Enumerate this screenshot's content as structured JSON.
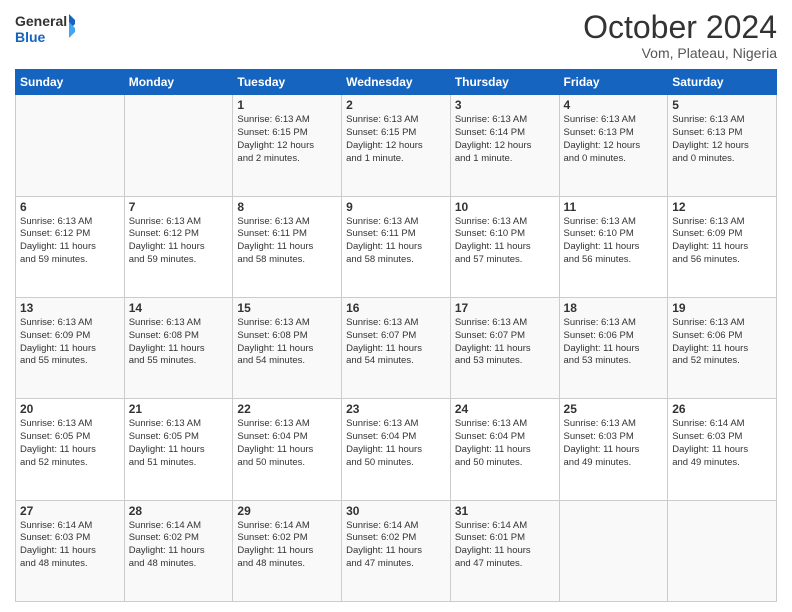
{
  "header": {
    "logo_general": "General",
    "logo_blue": "Blue",
    "month_title": "October 2024",
    "location": "Vom, Plateau, Nigeria"
  },
  "days_of_week": [
    "Sunday",
    "Monday",
    "Tuesday",
    "Wednesday",
    "Thursday",
    "Friday",
    "Saturday"
  ],
  "weeks": [
    [
      {
        "day": "",
        "info": ""
      },
      {
        "day": "",
        "info": ""
      },
      {
        "day": "1",
        "info": "Sunrise: 6:13 AM\nSunset: 6:15 PM\nDaylight: 12 hours\nand 2 minutes."
      },
      {
        "day": "2",
        "info": "Sunrise: 6:13 AM\nSunset: 6:15 PM\nDaylight: 12 hours\nand 1 minute."
      },
      {
        "day": "3",
        "info": "Sunrise: 6:13 AM\nSunset: 6:14 PM\nDaylight: 12 hours\nand 1 minute."
      },
      {
        "day": "4",
        "info": "Sunrise: 6:13 AM\nSunset: 6:13 PM\nDaylight: 12 hours\nand 0 minutes."
      },
      {
        "day": "5",
        "info": "Sunrise: 6:13 AM\nSunset: 6:13 PM\nDaylight: 12 hours\nand 0 minutes."
      }
    ],
    [
      {
        "day": "6",
        "info": "Sunrise: 6:13 AM\nSunset: 6:12 PM\nDaylight: 11 hours\nand 59 minutes."
      },
      {
        "day": "7",
        "info": "Sunrise: 6:13 AM\nSunset: 6:12 PM\nDaylight: 11 hours\nand 59 minutes."
      },
      {
        "day": "8",
        "info": "Sunrise: 6:13 AM\nSunset: 6:11 PM\nDaylight: 11 hours\nand 58 minutes."
      },
      {
        "day": "9",
        "info": "Sunrise: 6:13 AM\nSunset: 6:11 PM\nDaylight: 11 hours\nand 58 minutes."
      },
      {
        "day": "10",
        "info": "Sunrise: 6:13 AM\nSunset: 6:10 PM\nDaylight: 11 hours\nand 57 minutes."
      },
      {
        "day": "11",
        "info": "Sunrise: 6:13 AM\nSunset: 6:10 PM\nDaylight: 11 hours\nand 56 minutes."
      },
      {
        "day": "12",
        "info": "Sunrise: 6:13 AM\nSunset: 6:09 PM\nDaylight: 11 hours\nand 56 minutes."
      }
    ],
    [
      {
        "day": "13",
        "info": "Sunrise: 6:13 AM\nSunset: 6:09 PM\nDaylight: 11 hours\nand 55 minutes."
      },
      {
        "day": "14",
        "info": "Sunrise: 6:13 AM\nSunset: 6:08 PM\nDaylight: 11 hours\nand 55 minutes."
      },
      {
        "day": "15",
        "info": "Sunrise: 6:13 AM\nSunset: 6:08 PM\nDaylight: 11 hours\nand 54 minutes."
      },
      {
        "day": "16",
        "info": "Sunrise: 6:13 AM\nSunset: 6:07 PM\nDaylight: 11 hours\nand 54 minutes."
      },
      {
        "day": "17",
        "info": "Sunrise: 6:13 AM\nSunset: 6:07 PM\nDaylight: 11 hours\nand 53 minutes."
      },
      {
        "day": "18",
        "info": "Sunrise: 6:13 AM\nSunset: 6:06 PM\nDaylight: 11 hours\nand 53 minutes."
      },
      {
        "day": "19",
        "info": "Sunrise: 6:13 AM\nSunset: 6:06 PM\nDaylight: 11 hours\nand 52 minutes."
      }
    ],
    [
      {
        "day": "20",
        "info": "Sunrise: 6:13 AM\nSunset: 6:05 PM\nDaylight: 11 hours\nand 52 minutes."
      },
      {
        "day": "21",
        "info": "Sunrise: 6:13 AM\nSunset: 6:05 PM\nDaylight: 11 hours\nand 51 minutes."
      },
      {
        "day": "22",
        "info": "Sunrise: 6:13 AM\nSunset: 6:04 PM\nDaylight: 11 hours\nand 50 minutes."
      },
      {
        "day": "23",
        "info": "Sunrise: 6:13 AM\nSunset: 6:04 PM\nDaylight: 11 hours\nand 50 minutes."
      },
      {
        "day": "24",
        "info": "Sunrise: 6:13 AM\nSunset: 6:04 PM\nDaylight: 11 hours\nand 50 minutes."
      },
      {
        "day": "25",
        "info": "Sunrise: 6:13 AM\nSunset: 6:03 PM\nDaylight: 11 hours\nand 49 minutes."
      },
      {
        "day": "26",
        "info": "Sunrise: 6:14 AM\nSunset: 6:03 PM\nDaylight: 11 hours\nand 49 minutes."
      }
    ],
    [
      {
        "day": "27",
        "info": "Sunrise: 6:14 AM\nSunset: 6:03 PM\nDaylight: 11 hours\nand 48 minutes."
      },
      {
        "day": "28",
        "info": "Sunrise: 6:14 AM\nSunset: 6:02 PM\nDaylight: 11 hours\nand 48 minutes."
      },
      {
        "day": "29",
        "info": "Sunrise: 6:14 AM\nSunset: 6:02 PM\nDaylight: 11 hours\nand 48 minutes."
      },
      {
        "day": "30",
        "info": "Sunrise: 6:14 AM\nSunset: 6:02 PM\nDaylight: 11 hours\nand 47 minutes."
      },
      {
        "day": "31",
        "info": "Sunrise: 6:14 AM\nSunset: 6:01 PM\nDaylight: 11 hours\nand 47 minutes."
      },
      {
        "day": "",
        "info": ""
      },
      {
        "day": "",
        "info": ""
      }
    ]
  ]
}
